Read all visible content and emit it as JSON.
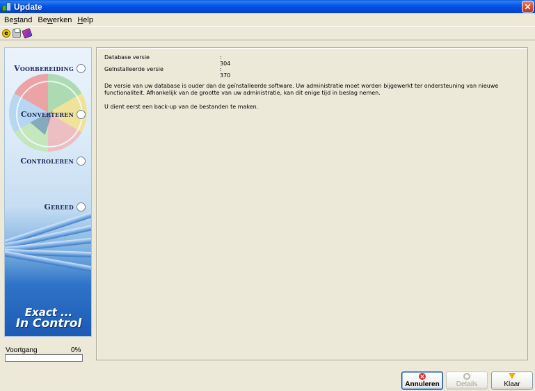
{
  "window": {
    "title": "Update",
    "close_glyph": "✕"
  },
  "menu": [
    {
      "label": "Bestand",
      "accel_index": 2
    },
    {
      "label": "Bewerken",
      "accel_index": 2
    },
    {
      "label": "Help",
      "accel_index": 0
    }
  ],
  "toolbar": {
    "icons": [
      "exact-e-icon",
      "printer-icon",
      "book-icon"
    ]
  },
  "steps": [
    {
      "label": "Voorbereiding"
    },
    {
      "label": "Converteren"
    },
    {
      "label": "Controleren"
    },
    {
      "label": "Gereed"
    }
  ],
  "brand": {
    "line1": "Exact ...",
    "line2": "In Control"
  },
  "progress": {
    "label": "Voortgang",
    "percent_text": "0%",
    "value": 0
  },
  "info": {
    "db_label": "Database versie",
    "db_value": ": 304",
    "installed_label": "Geïnstalleerde versie",
    "installed_value": ": 370"
  },
  "message": {
    "para1": "De versie van uw database is ouder dan de geïnstalleerde software. Uw administratie moet worden bijgewerkt ter ondersteuning van nieuwe functionaliteit. Afhankelijk van de grootte van uw administratie, kan dit enige tijd in beslag nemen.",
    "para2": "U dient eerst een back-up van de bestanden te maken."
  },
  "buttons": {
    "cancel": "Annuleren",
    "details": "Details",
    "done": "Klaar"
  }
}
